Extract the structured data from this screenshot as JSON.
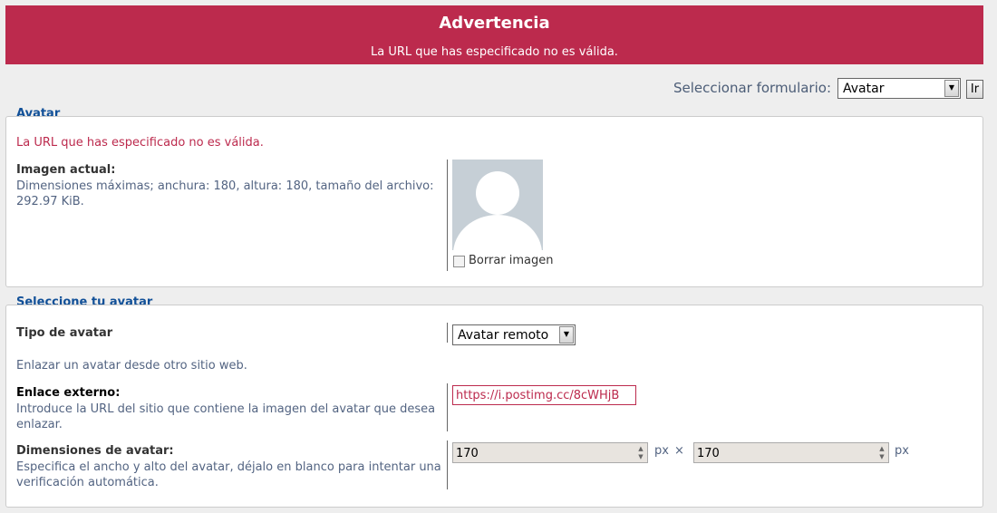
{
  "warning": {
    "title": "Advertencia",
    "message": "La URL que has especificado no es válida."
  },
  "form_selector": {
    "label": "Seleccionar formulario:",
    "selected": "Avatar",
    "go_label": "Ir"
  },
  "avatar_section": {
    "legend": "Avatar",
    "error": "La URL que has especificado no es válida.",
    "current_title": "Imagen actual:",
    "current_desc": "Dimensiones máximas; anchura: 180, altura: 180, tamaño del archivo: 292.97 KiB.",
    "delete_label": "Borrar imagen",
    "delete_checked": false
  },
  "select_avatar_section": {
    "legend": "Seleccione tu avatar",
    "type_title": "Tipo de avatar",
    "type_value": "Avatar remoto",
    "type_desc": "Enlazar un avatar desde otro sitio web.",
    "link_title": "Enlace externo:",
    "link_desc": "Introduce la URL del sitio que contiene la imagen del avatar que desea enlazar.",
    "link_value": "https://i.postimg.cc/8cWHjB",
    "dims_title": "Dimensiones de avatar:",
    "dims_desc": "Especifica el ancho y alto del avatar, déjalo en blanco para intentar una verificación automática.",
    "width_value": "170",
    "height_value": "170",
    "unit": "px",
    "times": "×"
  },
  "icons": {
    "dropdown": "chevron-down-icon",
    "spinner": "spinner-icon",
    "avatar": "default-avatar-icon"
  },
  "colors": {
    "warning_bg": "#bc2a4d",
    "legend": "#115098",
    "error": "#bc2a4d",
    "desc": "#536482",
    "avatar_placeholder": "#c6cfd6"
  }
}
